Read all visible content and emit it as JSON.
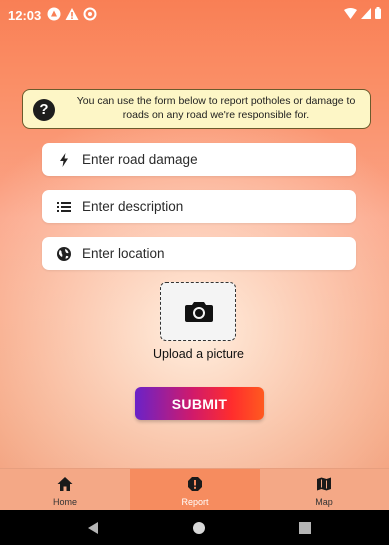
{
  "status_bar": {
    "time": "12:03"
  },
  "info": {
    "text": "You can use the form below to report potholes or damage to roads on any road we're responsible for."
  },
  "form": {
    "road_damage_placeholder": "Enter road damage",
    "description_placeholder": "Enter description",
    "location_placeholder": "Enter location",
    "upload_label": "Upload a picture",
    "submit_label": "SUBMIT"
  },
  "bottom_nav": {
    "items": [
      {
        "label": "Home",
        "icon": "home-icon",
        "active": false
      },
      {
        "label": "Report",
        "icon": "alert-icon",
        "active": true
      },
      {
        "label": "Map",
        "icon": "map-icon",
        "active": false
      }
    ]
  },
  "colors": {
    "accent": "#f68c5f",
    "submit_gradient_start": "#6a22c8",
    "submit_gradient_end": "#ff5a1f"
  }
}
